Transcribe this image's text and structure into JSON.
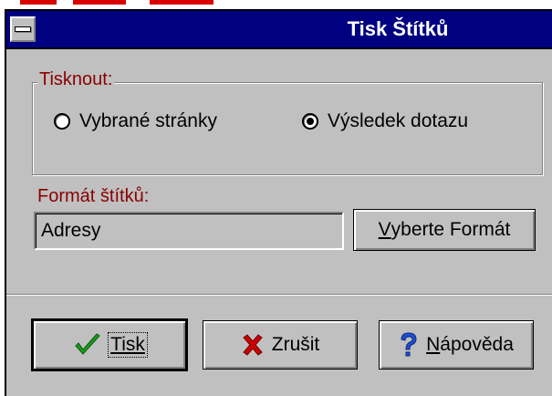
{
  "window": {
    "title": "Tisk Štítků"
  },
  "print_group": {
    "label": "Tisknout:",
    "options": [
      {
        "label": "Vybrané stránky",
        "checked": false
      },
      {
        "label": "Výsledek dotazu",
        "checked": true
      }
    ]
  },
  "format": {
    "label": "Formát štítků:",
    "value": "Adresy",
    "choose_button_label_accel": "V",
    "choose_button_label_rest": "yberte Formát"
  },
  "buttons": {
    "print_label": "Tisk",
    "cancel_label": "Zrušit",
    "help_label_accel": "N",
    "help_label_rest": "ápověda"
  },
  "colors": {
    "title_bar": "#000080",
    "dialog_bg": "#c0c0c0",
    "label_red": "#8b0000",
    "check_green": "#1a9a1a",
    "cross_red": "#cc0000",
    "help_blue": "#1e4fd0"
  },
  "icons": {
    "system_menu": "system-menu-icon",
    "print": "checkmark-icon",
    "cancel": "x-mark-icon",
    "help": "question-mark-icon"
  }
}
